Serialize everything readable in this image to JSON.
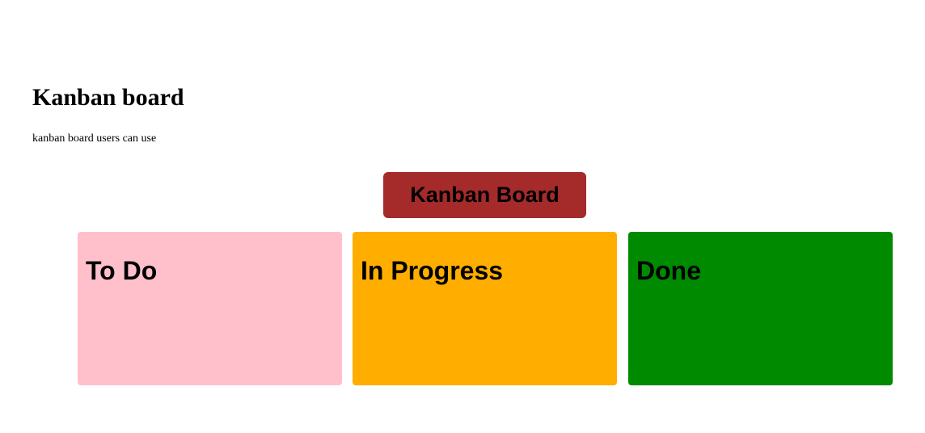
{
  "header": {
    "title": "Kanban board",
    "subtitle": "kanban board users can use"
  },
  "board_button": {
    "label": "Kanban Board",
    "color": "#a52a2a"
  },
  "columns": [
    {
      "title": "To Do",
      "color": "#ffc0cb"
    },
    {
      "title": "In Progress",
      "color": "#ffae00"
    },
    {
      "title": "Done",
      "color": "#008a00"
    }
  ]
}
